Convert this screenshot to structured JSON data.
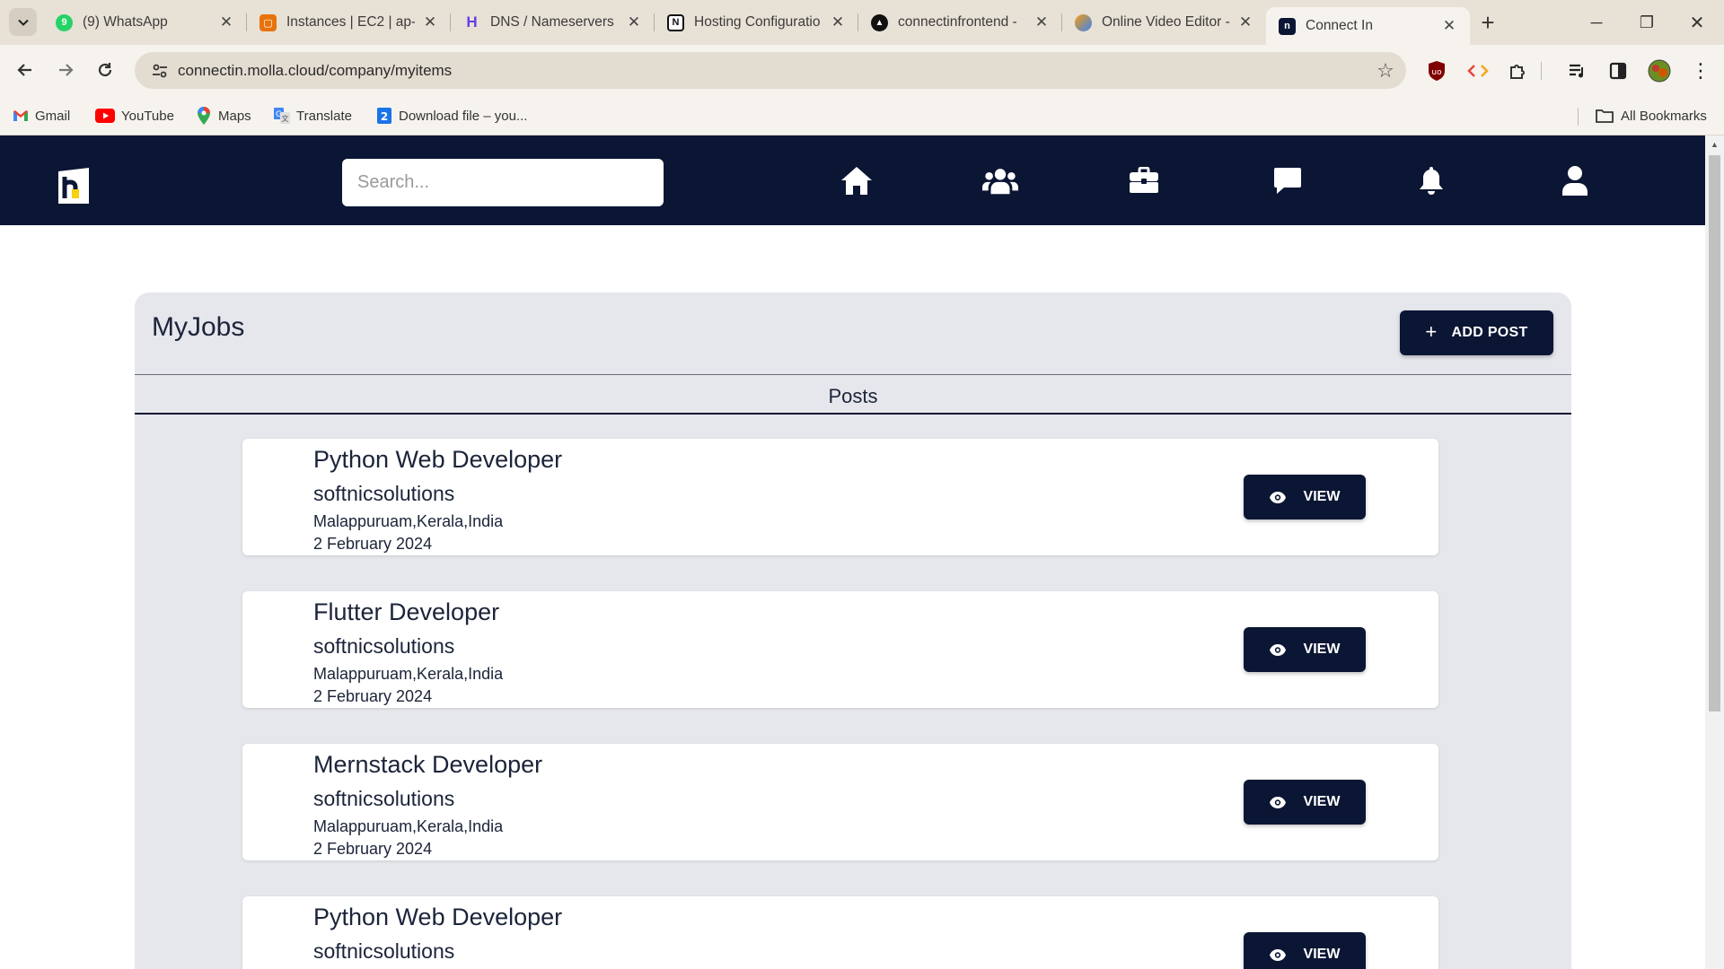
{
  "browser": {
    "tabs": [
      {
        "title": "(9) WhatsApp",
        "icon": "whatsapp-icon",
        "color": "#25d366"
      },
      {
        "title": "Instances | EC2 | ap-s",
        "icon": "aws-ec2-icon",
        "color": "#e8730c"
      },
      {
        "title": "DNS / Nameservers |",
        "icon": "hostinger-icon",
        "color": "#673de6"
      },
      {
        "title": "Hosting Configuratio",
        "icon": "notion-icon",
        "color": "#111111"
      },
      {
        "title": "connectinfrontend - ",
        "icon": "vercel-icon",
        "color": "#111111"
      },
      {
        "title": "Online Video Editor -",
        "icon": "video-editor-icon",
        "color": "#f59e0b"
      },
      {
        "title": "Connect In",
        "icon": "connectin-icon",
        "color": "#0b1634",
        "active": true
      }
    ],
    "url": "connectin.molla.cloud/company/myitems",
    "bookmarks": [
      {
        "label": "Gmail",
        "icon": "gmail-icon"
      },
      {
        "label": "YouTube",
        "icon": "youtube-icon"
      },
      {
        "label": "Maps",
        "icon": "maps-icon"
      },
      {
        "label": "Translate",
        "icon": "translate-icon"
      },
      {
        "label": "Download file – you...",
        "icon": "download-file-icon"
      }
    ],
    "all_bookmarks": "All Bookmarks"
  },
  "app": {
    "search_placeholder": "Search...",
    "nav": [
      "home-icon",
      "network-icon",
      "jobs-icon",
      "messages-icon",
      "notifications-icon",
      "profile-icon"
    ],
    "accent": "#0b1634"
  },
  "main": {
    "title": "MyJobs",
    "add_post_label": "ADD POST",
    "tab_label": "Posts",
    "view_label": "VIEW",
    "jobs": [
      {
        "title": "Python Web Developer",
        "company": "softnicsolutions",
        "location": "Malappuruam,Kerala,India",
        "date": "2 February 2024"
      },
      {
        "title": "Flutter Developer",
        "company": "softnicsolutions",
        "location": "Malappuruam,Kerala,India",
        "date": "2 February 2024"
      },
      {
        "title": "Mernstack Developer",
        "company": "softnicsolutions",
        "location": "Malappuruam,Kerala,India",
        "date": "2 February 2024"
      },
      {
        "title": "Python Web Developer",
        "company": "softnicsolutions",
        "location": "",
        "date": ""
      }
    ]
  }
}
